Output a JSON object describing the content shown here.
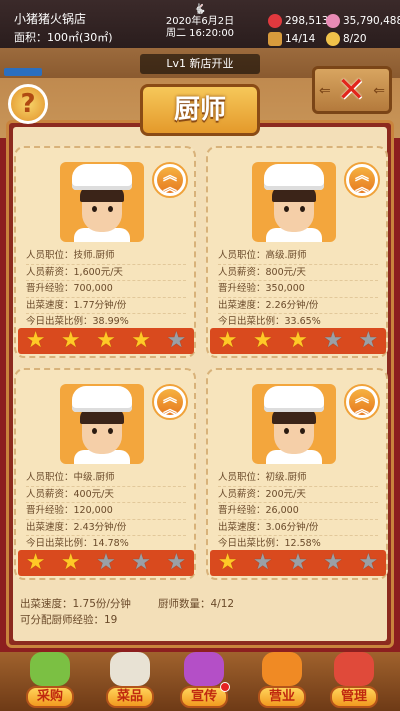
{
  "header": {
    "shop_name": "小猪猪火锅店",
    "area": "面积：100㎡(30㎡)",
    "date": "2020年6月2日",
    "weekday_time": "周二 16:20:00",
    "money": "298,513",
    "gems": "35,790,488",
    "tables": "14/14",
    "staff": "8/20"
  },
  "level_banner": "Lv1 新店开业",
  "title": "厨师",
  "help_label": "?",
  "close_label": "✕",
  "field_labels": {
    "position": "人员职位：",
    "salary": "人员薪资：",
    "exp": "晋升经验：",
    "speed": "出菜速度：",
    "ratio": "今日出菜比例："
  },
  "chefs": [
    {
      "position": "技师.厨师",
      "salary": "1,600元/天",
      "exp": "700,000",
      "speed": "1.77分钟/份",
      "ratio": "38.99%",
      "stars": 4
    },
    {
      "position": "高级.厨师",
      "salary": "800元/天",
      "exp": "350,000",
      "speed": "2.26分钟/份",
      "ratio": "33.65%",
      "stars": 3
    },
    {
      "position": "中级.厨师",
      "salary": "400元/天",
      "exp": "120,000",
      "speed": "2.43分钟/份",
      "ratio": "14.78%",
      "stars": 2
    },
    {
      "position": "初级.厨师",
      "salary": "200元/天",
      "exp": "26,000",
      "speed": "3.06分钟/份",
      "ratio": "12.58%",
      "stars": 1
    }
  ],
  "footer": {
    "speed": "出菜速度：1.75份/分钟",
    "chef_count": "厨师数量：4/12",
    "assignable_exp": "可分配厨师经验：19"
  },
  "nav": [
    {
      "label": "采购",
      "icon": "vegetables-basket-icon",
      "color": "#7bc043"
    },
    {
      "label": "菜品",
      "icon": "dish-plate-icon",
      "color": "#e8e2d4"
    },
    {
      "label": "宣传",
      "icon": "video-camera-icon",
      "color": "#b44fc7",
      "badge": true
    },
    {
      "label": "营业",
      "icon": "cloche-bell-icon",
      "color": "#f08a24"
    },
    {
      "label": "管理",
      "icon": "manager-person-icon",
      "color": "#e04a3a"
    }
  ]
}
